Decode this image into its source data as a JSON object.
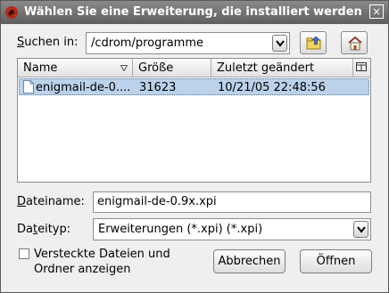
{
  "title": "Wählen Sie eine Erweiterung, die installiert werden",
  "close_label": "×",
  "lookin": {
    "label_u": "S",
    "label_rest": "uchen in:",
    "value": "/cdrom/programme"
  },
  "table": {
    "headers": [
      "Name",
      "Größe",
      "Zuletzt geändert"
    ],
    "rows": [
      {
        "name": "enigmail-de-0....",
        "size": "31623",
        "modified": "10/21/05 22:48:56"
      }
    ]
  },
  "filename": {
    "label_u": "D",
    "label_rest": "ateiname:",
    "value": "enigmail-de-0.9x.xpi"
  },
  "filetype": {
    "label_pre": "Da",
    "label_u": "t",
    "label_rest": "eityp:",
    "value": "Erweiterungen (*.xpi) (*.xpi)"
  },
  "hidden_files": {
    "line1": "Versteckte Dateien und",
    "line2": "Ordner anzeigen",
    "checked": false
  },
  "buttons": {
    "cancel": "Abbrechen",
    "open": "Öffnen"
  },
  "icons": {
    "app": "mozilla-lizard-icon",
    "up": "folder-up-icon",
    "home": "home-icon",
    "file": "file-icon",
    "sort": "sort-indicator-icon",
    "column_picker": "column-picker-icon"
  }
}
